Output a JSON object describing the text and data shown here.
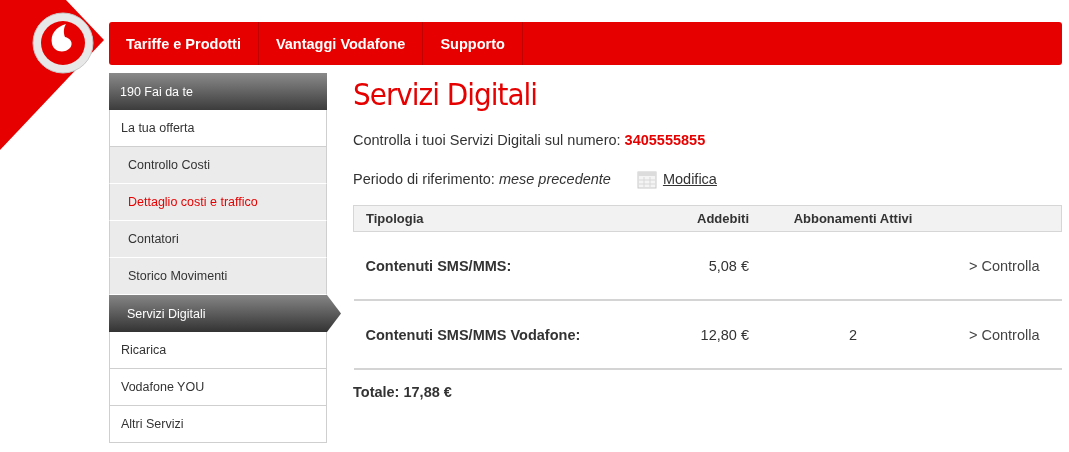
{
  "nav": {
    "items": [
      {
        "label": "Tariffe e Prodotti"
      },
      {
        "label": "Vantaggi Vodafone"
      },
      {
        "label": "Supporto"
      }
    ]
  },
  "sidebar": {
    "title": "190 Fai da te",
    "items": [
      {
        "kind": "section",
        "label": "La tua offerta",
        "selected": false,
        "active": false
      },
      {
        "kind": "sub",
        "label": "Controllo Costi",
        "selected": false,
        "active": false
      },
      {
        "kind": "sub",
        "label": "Dettaglio costi e traffico",
        "selected": false,
        "active": true
      },
      {
        "kind": "sub",
        "label": "Contatori",
        "selected": false,
        "active": false
      },
      {
        "kind": "sub",
        "label": "Storico Movimenti",
        "selected": false,
        "active": false
      },
      {
        "kind": "sub",
        "label": "Servizi Digitali",
        "selected": true,
        "active": false
      },
      {
        "kind": "section",
        "label": "Ricarica",
        "selected": false,
        "active": false
      },
      {
        "kind": "section",
        "label": "Vodafone YOU",
        "selected": false,
        "active": false
      },
      {
        "kind": "section",
        "label": "Altri Servizi",
        "selected": false,
        "active": false
      }
    ]
  },
  "content": {
    "title": "Servizi Digitali",
    "intro": "Controlla i tuoi Servizi Digitali sul numero:",
    "number": "3405555855",
    "period": "Periodo di riferimento: *mese precedente*",
    "edit_link": "Modifica",
    "table": {
      "columns": [
        "Tipologia",
        "Addebiti",
        "Abbonamenti Attivi"
      ],
      "rows": [
        {
          "type": "Contenuti SMS/MMS:",
          "charges": "5,08 €",
          "link": "> Controlla"
        },
        {
          "type": "Contenuti SMS/MMS Vodafone:",
          "charges": "12,80 €",
          "active_subscriptions": "2",
          "link": "> Controlla"
        }
      ]
    },
    "total": "Totale: 17,88 €"
  }
}
